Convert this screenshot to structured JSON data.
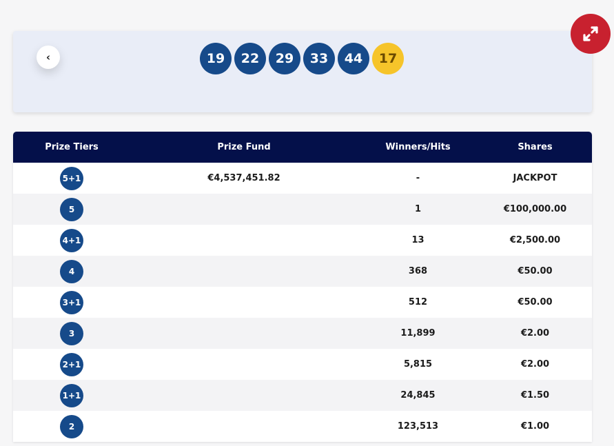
{
  "draw": {
    "back_icon": "chevron-left-icon",
    "balls": [
      "19",
      "22",
      "29",
      "33",
      "44"
    ],
    "bonus_ball": "17",
    "ball_color": "#164a8a",
    "bonus_color": "#f6c42a"
  },
  "expand": {
    "icon": "expand-arrows-icon",
    "color": "#c8212f"
  },
  "table": {
    "headers": [
      "Prize Tiers",
      "Prize Fund",
      "Winners/Hits",
      "Shares"
    ],
    "rows": [
      {
        "tier": "5+1",
        "fund": "€4,537,451.82",
        "winners": "-",
        "share": "JACKPOT"
      },
      {
        "tier": "5",
        "fund": "",
        "winners": "1",
        "share": "€100,000.00"
      },
      {
        "tier": "4+1",
        "fund": "",
        "winners": "13",
        "share": "€2,500.00"
      },
      {
        "tier": "4",
        "fund": "",
        "winners": "368",
        "share": "€50.00"
      },
      {
        "tier": "3+1",
        "fund": "",
        "winners": "512",
        "share": "€50.00"
      },
      {
        "tier": "3",
        "fund": "",
        "winners": "11,899",
        "share": "€2.00"
      },
      {
        "tier": "2+1",
        "fund": "",
        "winners": "5,815",
        "share": "€2.00"
      },
      {
        "tier": "1+1",
        "fund": "",
        "winners": "24,845",
        "share": "€1.50"
      },
      {
        "tier": "2",
        "fund": "",
        "winners": "123,513",
        "share": "€1.00"
      }
    ],
    "header_color": "#04104a"
  }
}
